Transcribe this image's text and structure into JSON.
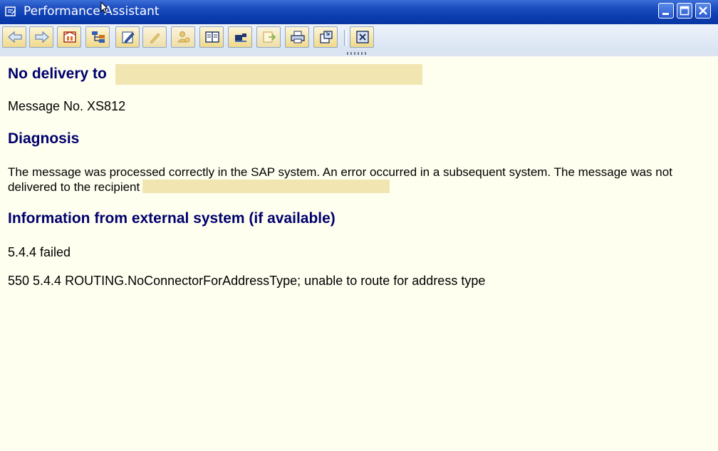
{
  "window": {
    "title": "Performance Assistant",
    "controls": [
      "minimize",
      "maximize",
      "close"
    ]
  },
  "toolbar": {
    "buttons": [
      {
        "icon": "back-arrow-icon"
      },
      {
        "icon": "forward-arrow-icon"
      },
      {
        "icon": "technical-info-icon"
      },
      {
        "icon": "hierarchy-icon"
      },
      {
        "icon": "edit-pencil-icon"
      },
      {
        "icon": "edit-disabled-icon"
      },
      {
        "icon": "user-settings-icon"
      },
      {
        "icon": "book-icon"
      },
      {
        "icon": "overview-icon"
      },
      {
        "icon": "export-disabled-icon"
      },
      {
        "icon": "print-icon"
      },
      {
        "icon": "window-icon"
      },
      {
        "icon": "close-icon"
      }
    ]
  },
  "content": {
    "title": "No delivery to",
    "message_no": "Message No. XS812",
    "diagnosis_heading": "Diagnosis",
    "diagnosis_text": "The message was processed correctly in the SAP system. An error occurred in a subsequent system. The message was not delivered to the recipient",
    "info_heading": "Information from external system (if available)",
    "info_line1": "5.4.4 failed",
    "info_line2": "550 5.4.4 ROUTING.NoConnectorForAddressType; unable to route for address type"
  },
  "colors": {
    "heading": "#00006e",
    "background": "#fffff0",
    "redaction": "#f1e5b2",
    "titlebar": "#0b3cb0"
  }
}
